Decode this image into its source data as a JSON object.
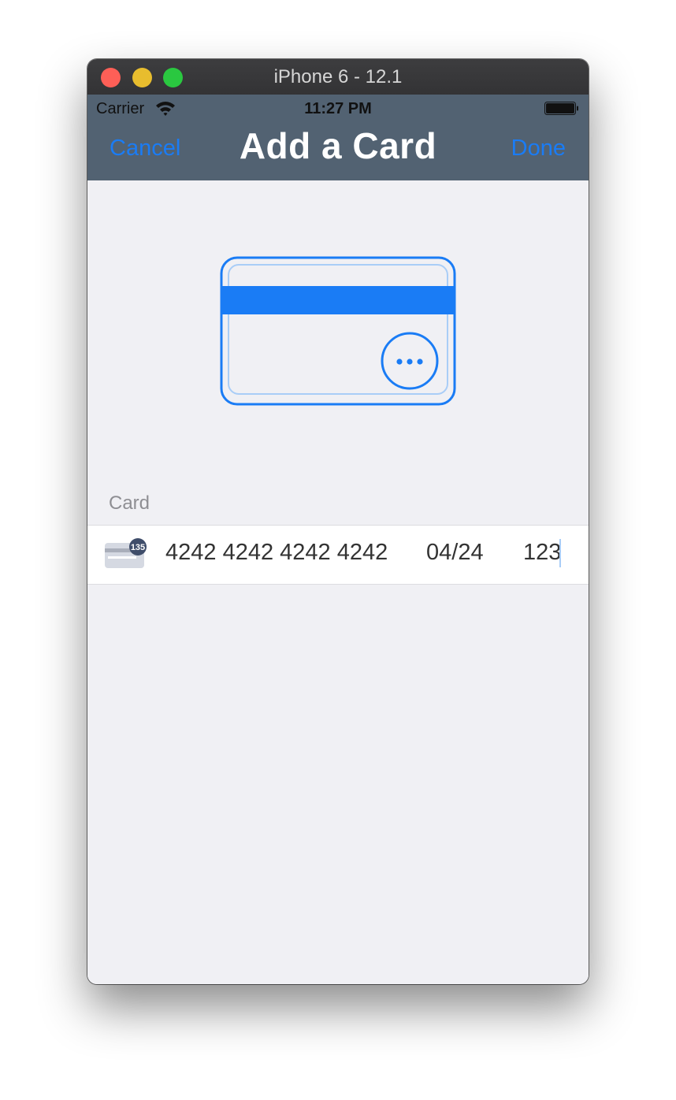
{
  "window": {
    "title": "iPhone 6 - 12.1"
  },
  "status_bar": {
    "carrier": "Carrier",
    "time": "11:27 PM"
  },
  "nav": {
    "cancel_label": "Cancel",
    "title": "Add a Card",
    "done_label": "Done"
  },
  "form": {
    "section_header": "Card",
    "card_number": "4242 4242 4242 4242",
    "expiry": "04/24",
    "cvc": "123",
    "brand_badge": "135"
  },
  "colors": {
    "accent": "#1a7cf5",
    "navbar": "#526272",
    "background": "#f0f0f4"
  },
  "icons": [
    "close-button",
    "minimize-button",
    "zoom-button",
    "wifi-icon",
    "battery-icon",
    "card-illustration",
    "card-brand-icon"
  ]
}
